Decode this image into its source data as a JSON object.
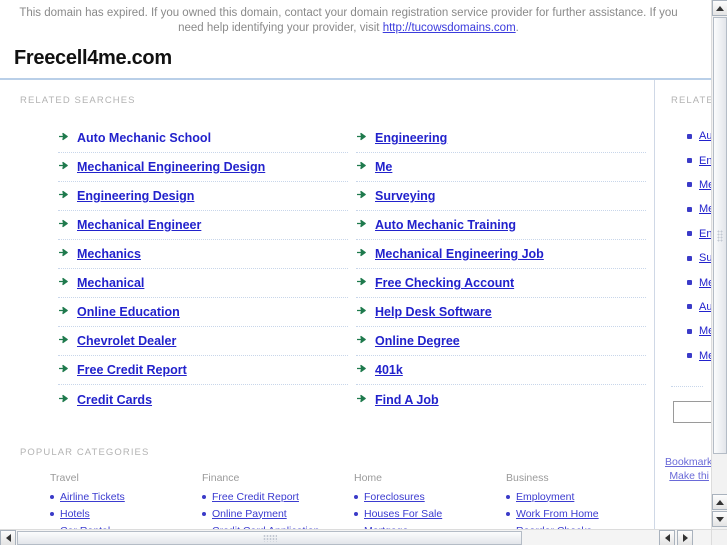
{
  "notice": {
    "text_before_link": "This domain has expired. If you owned this domain, contact your domain registration service provider for further assistance. If you need help identifying your provider, visit ",
    "link_text": "http://tucowsdomains.com",
    "text_after_link": "."
  },
  "header": {
    "domain_title": "Freecell4me.com"
  },
  "main": {
    "related_searches_label": "RELATED SEARCHES",
    "popular_categories_label": "POPULAR CATEGORIES",
    "related_searches": {
      "left_column": [
        "Auto Mechanic School",
        "Mechanical Engineering Design",
        "Engineering Design",
        "Mechanical Engineer",
        "Mechanics",
        "Mechanical",
        "Online Education",
        "Chevrolet Dealer",
        "Free Credit Report",
        "Credit Cards"
      ],
      "right_column": [
        "Engineering",
        "Me",
        "Surveying",
        "Auto Mechanic Training",
        "Mechanical Engineering Job",
        "Free Checking Account",
        "Help Desk Software",
        "Online Degree",
        "401k",
        "Find A Job"
      ]
    },
    "popular_categories": [
      {
        "heading": "Travel",
        "links": [
          "Airline Tickets",
          "Hotels",
          "Car Rental"
        ]
      },
      {
        "heading": "Finance",
        "links": [
          "Free Credit Report",
          "Online Payment",
          "Credit Card Application"
        ]
      },
      {
        "heading": "Home",
        "links": [
          "Foreclosures",
          "Houses For Sale",
          "Mortgage"
        ]
      },
      {
        "heading": "Business",
        "links": [
          "Employment",
          "Work From Home",
          "Reorder Checks"
        ]
      }
    ]
  },
  "sidebar": {
    "label": "RELATED",
    "items": [
      "Au",
      "En",
      "Me",
      "Me",
      "En",
      "Su",
      "Me",
      "Au",
      "Me",
      "Me"
    ],
    "search_value": "",
    "footer_links": [
      "Bookmark",
      "Make thi"
    ]
  },
  "colors": {
    "link": "#2222cc",
    "arrow": "#1f7a4d",
    "notice_text": "#8a8a8a",
    "rule": "#b9cfe8",
    "dotted_separator": "#c8d6ea",
    "section_label": "#b3b3b3"
  },
  "scrollbars": {
    "vertical": {
      "up_arrow": "scroll-up-icon",
      "down_arrow": "scroll-down-icon"
    },
    "horizontal": {
      "left_arrow": "scroll-left-icon",
      "right_arrow": "scroll-right-icon"
    }
  }
}
